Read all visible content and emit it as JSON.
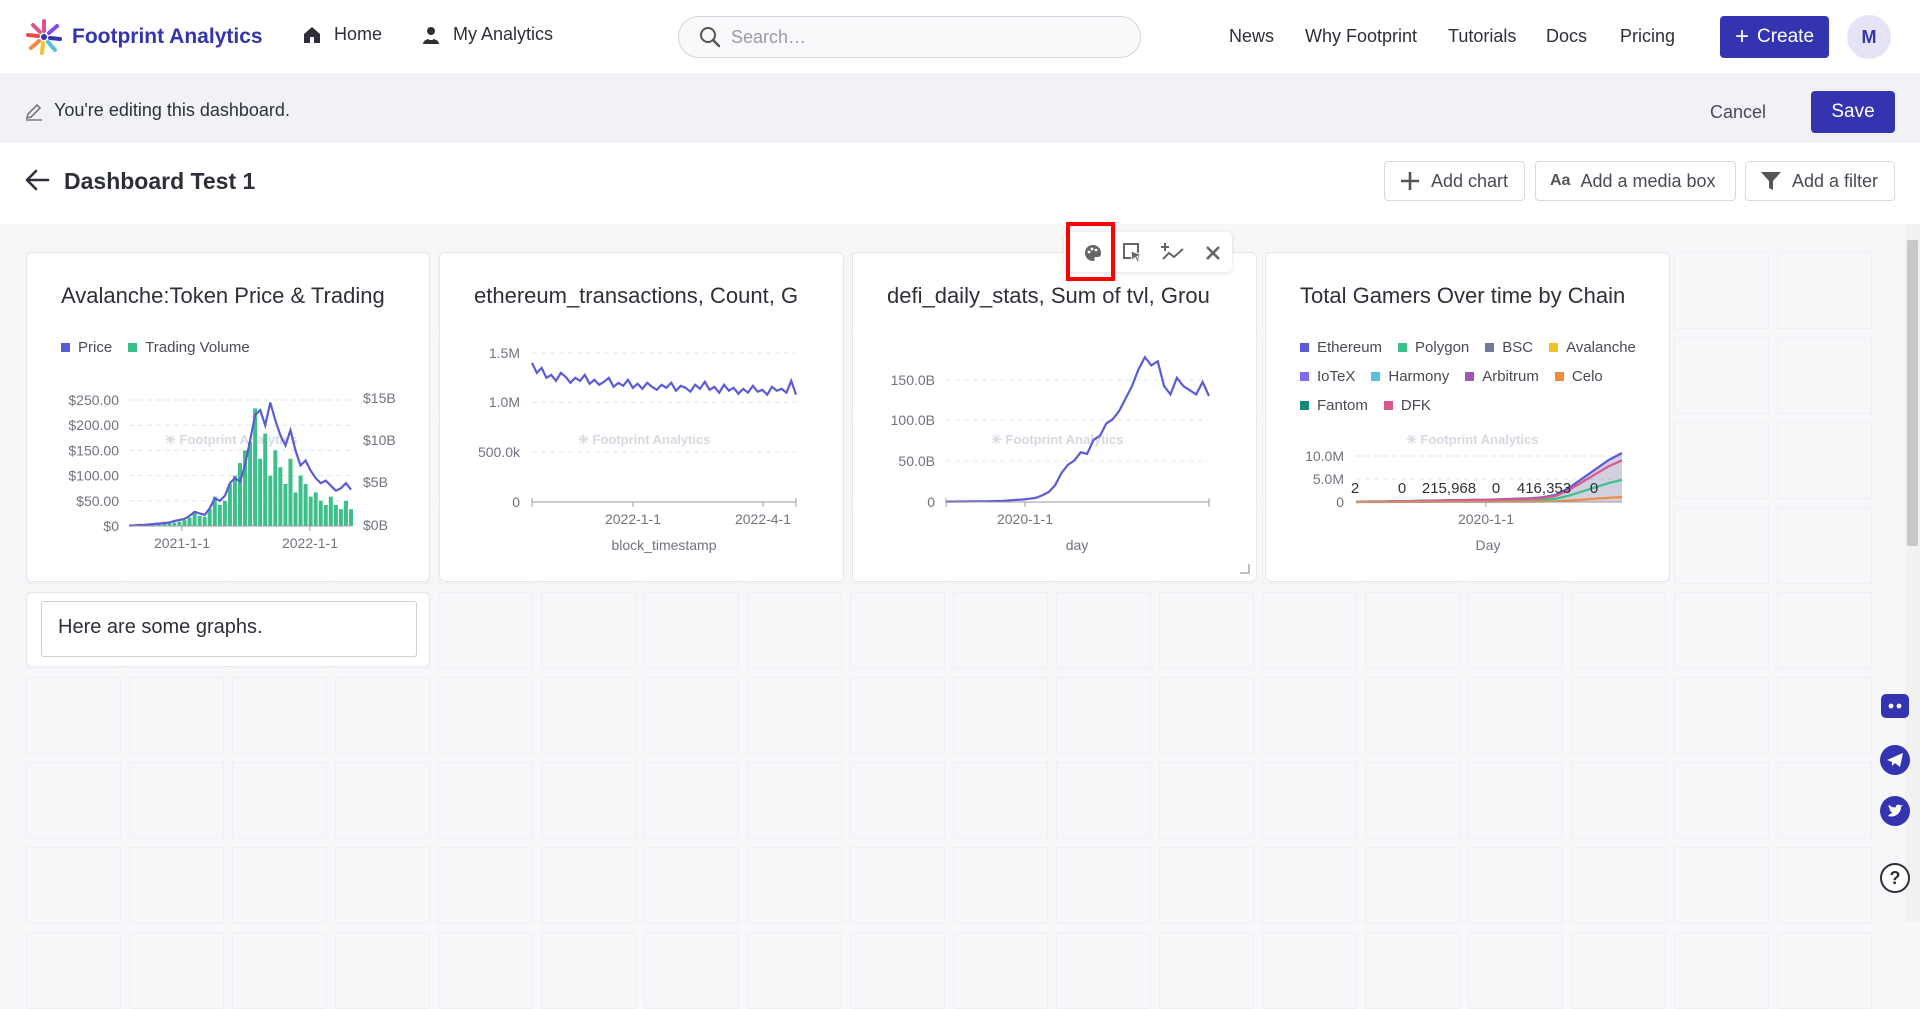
{
  "nav": {
    "brand": "Footprint Analytics",
    "home": "Home",
    "my_analytics": "My Analytics",
    "search_placeholder": "Search…",
    "links": [
      "News",
      "Why Footprint",
      "Tutorials",
      "Docs",
      "Pricing"
    ],
    "create": "Create",
    "avatar": "M",
    "accent": "#3434b0"
  },
  "editbar": {
    "message": "You're editing this dashboard.",
    "cancel": "Cancel",
    "save": "Save"
  },
  "dashboard": {
    "title": "Dashboard Test 1",
    "add_chart": "Add chart",
    "add_media_icon": "Aa",
    "add_media": "Add a media box",
    "add_filter": "Add a filter"
  },
  "watermark": "Footprint Analytics",
  "text_card": "Here are some graphs.",
  "chart_data": [
    {
      "type": "area",
      "title": "Avalanche:Token Price & Trading",
      "series": [
        {
          "name": "Price",
          "color": "#5b5bd6",
          "axis": "left"
        },
        {
          "name": "Trading Volume",
          "color": "#3dbf8a",
          "axis": "right"
        }
      ],
      "y_ticks": [
        "$250.00",
        "$200.00",
        "$150.00",
        "$100.00",
        "$50.00",
        "$0"
      ],
      "y2_ticks": [
        "$15B",
        "$10B",
        "$5B",
        "$0B"
      ],
      "x_ticks": [
        "2021-1-1",
        "2022-1-1"
      ],
      "ylim": [
        0,
        250
      ],
      "price": [
        1,
        1,
        2,
        2,
        3,
        4,
        5,
        6,
        7,
        10,
        12,
        14,
        20,
        28,
        25,
        22,
        35,
        55,
        50,
        60,
        85,
        95,
        88,
        120,
        170,
        220,
        230,
        200,
        245,
        210,
        180,
        160,
        190,
        150,
        120,
        130,
        110,
        95,
        85,
        90,
        80,
        70,
        75,
        85,
        72
      ],
      "volume": [
        0,
        0,
        0,
        0,
        0.1,
        0.1,
        0.2,
        0.3,
        0.3,
        0.4,
        0.5,
        0.7,
        1,
        1.5,
        1.2,
        1.1,
        2,
        3.5,
        2.5,
        3,
        5,
        6,
        7.5,
        9,
        10,
        14,
        8,
        11,
        6,
        9,
        7,
        5,
        8,
        4,
        6,
        5,
        3.5,
        4,
        3,
        2.5,
        3.5,
        2.5,
        2,
        3,
        2
      ]
    },
    {
      "type": "line",
      "title": "ethereum_transactions, Count, G",
      "color": "#5b5bd6",
      "xlabel": "block_timestamp",
      "y_ticks": [
        "1.5M",
        "1.0M",
        "500.0k",
        "0"
      ],
      "x_ticks": [
        "2022-1-1",
        "2022-4-1"
      ],
      "ylim": [
        0,
        1500000
      ],
      "values": [
        1400000,
        1300000,
        1350000,
        1250000,
        1280000,
        1220000,
        1300000,
        1260000,
        1200000,
        1250000,
        1220000,
        1280000,
        1190000,
        1230000,
        1180000,
        1210000,
        1250000,
        1160000,
        1200000,
        1170000,
        1230000,
        1150000,
        1190000,
        1140000,
        1200000,
        1160000,
        1130000,
        1180000,
        1150000,
        1200000,
        1120000,
        1170000,
        1150000,
        1110000,
        1180000,
        1140000,
        1210000,
        1130000,
        1160000,
        1100000,
        1180000,
        1120000,
        1150000,
        1090000,
        1140000,
        1100000,
        1170000,
        1110000,
        1130000,
        1080000,
        1160000,
        1120000,
        1140000,
        1100000,
        1220000,
        1080000
      ]
    },
    {
      "type": "line",
      "title": "defi_daily_stats, Sum of tvl, Grou",
      "color": "#5b5bd6",
      "xlabel": "day",
      "y_ticks": [
        "150.0B",
        "100.0B",
        "50.0B",
        "0"
      ],
      "x_ticks": [
        "2020-1-1"
      ],
      "ylim": [
        0,
        180
      ],
      "values": [
        0.5,
        0.5,
        0.6,
        0.6,
        0.7,
        0.8,
        0.9,
        1,
        1.2,
        1.5,
        2,
        2.5,
        3,
        4,
        5,
        8,
        12,
        20,
        35,
        45,
        50,
        60,
        58,
        75,
        80,
        95,
        100,
        110,
        125,
        140,
        160,
        175,
        165,
        170,
        140,
        130,
        150,
        140,
        135,
        130,
        145,
        128
      ]
    },
    {
      "type": "area",
      "title": "Total Gamers Over time by Chain",
      "xlabel": "Day",
      "series": [
        {
          "name": "Ethereum",
          "color": "#5b5bd6"
        },
        {
          "name": "Polygon",
          "color": "#3dbf8a"
        },
        {
          "name": "BSC",
          "color": "#6f7a94"
        },
        {
          "name": "Avalanche",
          "color": "#f2c12e"
        },
        {
          "name": "IoTeX",
          "color": "#7b6cf0"
        },
        {
          "name": "Harmony",
          "color": "#5bc0de"
        },
        {
          "name": "Arbitrum",
          "color": "#9b59b6"
        },
        {
          "name": "Celo",
          "color": "#f08a3e"
        },
        {
          "name": "Fantom",
          "color": "#138a7a"
        },
        {
          "name": "DFK",
          "color": "#d9578f"
        }
      ],
      "y_ticks": [
        "10.0M",
        "5.0M",
        "0"
      ],
      "x_ticks": [
        "2020-1-1"
      ],
      "data_labels": [
        "2",
        "0",
        "215,968",
        "0",
        "416,353",
        "0"
      ],
      "ylim": [
        0,
        10
      ],
      "total": [
        0,
        0.1,
        0.1,
        0.2,
        0.2,
        0.3,
        0.3,
        0.4,
        0.4,
        0.5,
        0.5,
        0.6,
        0.7,
        0.8,
        1,
        1.5,
        3,
        5,
        7,
        9,
        10.5
      ]
    }
  ]
}
